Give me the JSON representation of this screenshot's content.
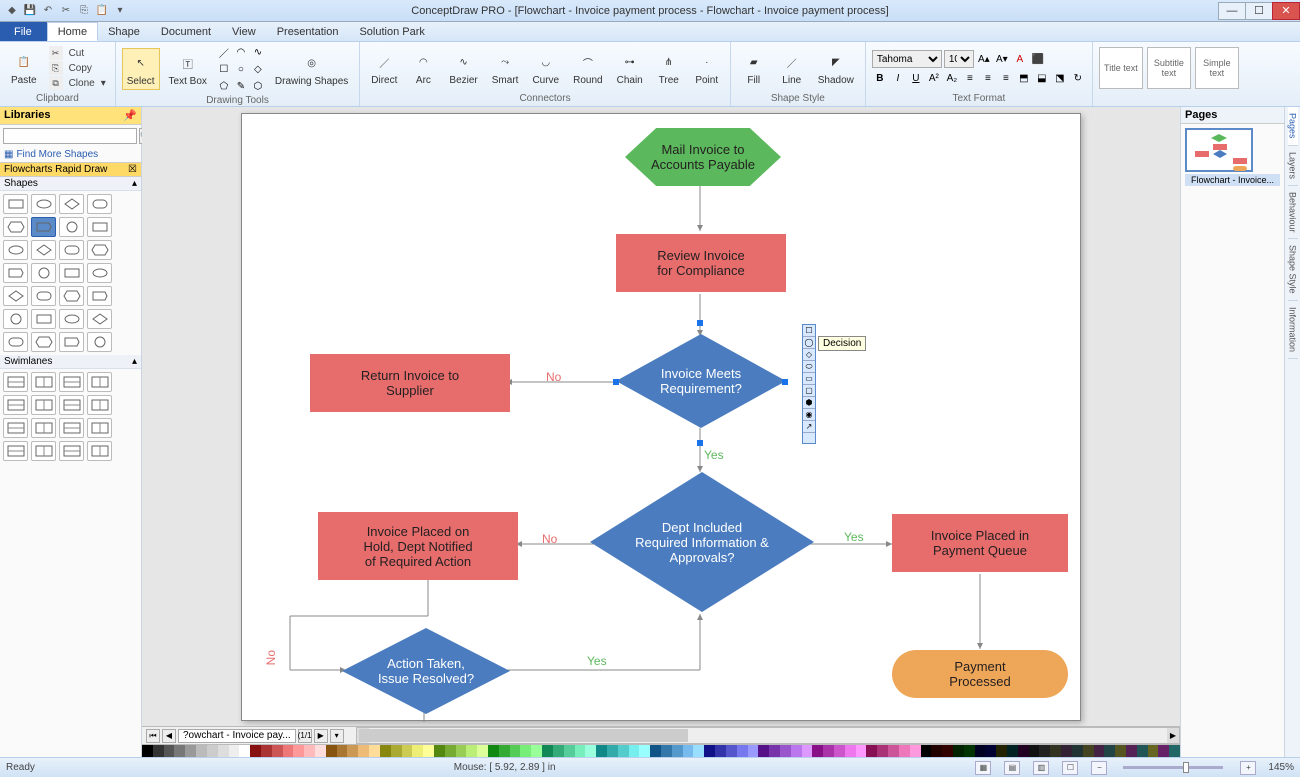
{
  "app_title": "ConceptDraw PRO - [Flowchart - Invoice payment process - Flowchart - Invoice payment process]",
  "menu": {
    "file": "File",
    "tabs": [
      "Home",
      "Shape",
      "Document",
      "View",
      "Presentation",
      "Solution Park"
    ],
    "active": "Home"
  },
  "ribbon": {
    "clipboard": {
      "label": "Clipboard",
      "paste": "Paste",
      "cut": "Cut",
      "copy": "Copy",
      "clone": "Clone"
    },
    "drawing": {
      "label": "Drawing Tools",
      "select": "Select",
      "textbox": "Text Box",
      "shapes": "Drawing Shapes"
    },
    "connectors": {
      "label": "Connectors",
      "items": [
        "Direct",
        "Arc",
        "Bezier",
        "Smart",
        "Curve",
        "Round",
        "Chain",
        "Tree",
        "Point"
      ]
    },
    "shapestyle": {
      "label": "Shape Style",
      "fill": "Fill",
      "line": "Line",
      "shadow": "Shadow"
    },
    "textformat": {
      "label": "Text Format",
      "font": "Tahoma",
      "size": "10"
    },
    "styles": [
      "Title text",
      "Subtitle text",
      "Simple text"
    ]
  },
  "libraries": {
    "title": "Libraries",
    "findmore": "Find More Shapes",
    "cat": "Flowcharts Rapid Draw",
    "sec_shapes": "Shapes",
    "sec_swimlanes": "Swimlanes"
  },
  "pages_panel": {
    "title": "Pages",
    "thumb_label": "Flowchart - Invoice..."
  },
  "right_rail": [
    "Pages",
    "Layers",
    "Behaviour",
    "Shape Style",
    "Information"
  ],
  "flow": {
    "start": "Mail Invoice to\nAccounts Payable",
    "review": "Review Invoice\nfor Compliance",
    "meets": "Invoice Meets\nRequirement?",
    "return_supplier": "Return Invoice to\nSupplier",
    "dept": "Dept Included\nRequired Information &\nApprovals?",
    "hold": "Invoice Placed on\nHold, Dept Notified\nof Required Action",
    "queue": "Invoice Placed in\nPayment Queue",
    "action": "Action Taken,\nIssue Resolved?",
    "processed": "Payment\nProcessed",
    "no": "No",
    "yes": "Yes",
    "tooltip": "Decision"
  },
  "tabs": {
    "name": "?owchart - Invoice pay...",
    "count": "(1/1"
  },
  "status": {
    "ready": "Ready",
    "mouse": "Mouse: [ 5.92, 2.89 ] in",
    "zoom": "145%"
  },
  "palette": [
    "#000",
    "#333",
    "#555",
    "#777",
    "#999",
    "#bbb",
    "#ccc",
    "#ddd",
    "#eee",
    "#fff",
    "#811",
    "#a33",
    "#c55",
    "#e77",
    "#f99",
    "#fbb",
    "#fdd",
    "#851",
    "#a73",
    "#c95",
    "#eb7",
    "#fd9",
    "#881",
    "#aa3",
    "#cc5",
    "#ee7",
    "#ff9",
    "#581",
    "#7a3",
    "#9c5",
    "#be7",
    "#df9",
    "#181",
    "#3a3",
    "#5c5",
    "#7e7",
    "#9f9",
    "#185",
    "#3a7",
    "#5c9",
    "#7eb",
    "#9fd",
    "#188",
    "#3aa",
    "#5cc",
    "#7ee",
    "#9ff",
    "#158",
    "#37a",
    "#59c",
    "#7be",
    "#9df",
    "#118",
    "#33a",
    "#55c",
    "#77e",
    "#99f",
    "#518",
    "#73a",
    "#95c",
    "#b7e",
    "#d9f",
    "#818",
    "#a3a",
    "#c5c",
    "#e7e",
    "#f9f",
    "#815",
    "#a37",
    "#c59",
    "#e7b",
    "#f9d",
    "#000",
    "#200",
    "#300",
    "#020",
    "#030",
    "#002",
    "#003",
    "#220",
    "#022",
    "#202",
    "#111",
    "#222",
    "#332",
    "#323",
    "#233",
    "#442",
    "#424",
    "#244",
    "#552",
    "#525",
    "#255",
    "#662",
    "#626",
    "#266"
  ]
}
